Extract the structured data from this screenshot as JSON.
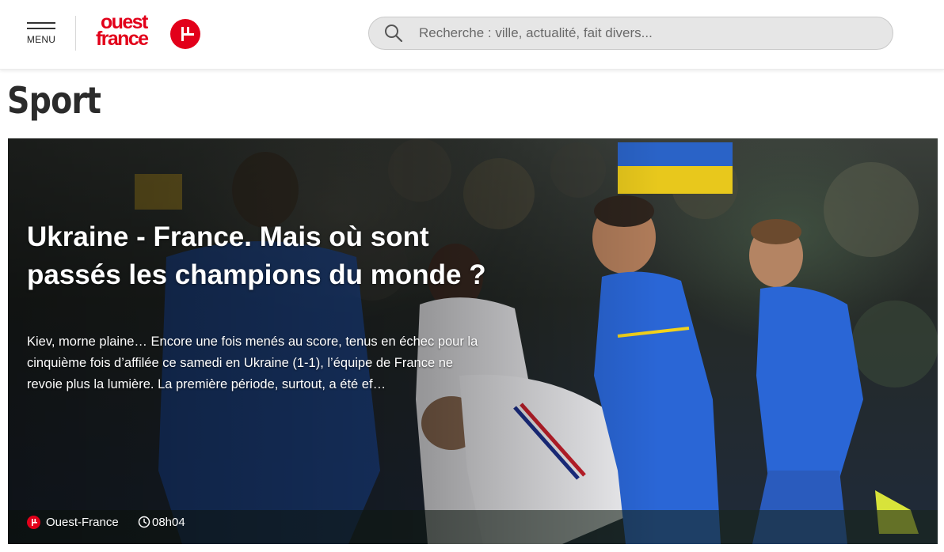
{
  "header": {
    "menu_label": "MENU",
    "logo": {
      "line1": "ouest",
      "line2": "france",
      "brand_color": "#e2001a"
    },
    "search": {
      "placeholder": "Recherche : ville, actualité, fait divers...",
      "icon": "search-icon"
    }
  },
  "section": {
    "title": "Sport"
  },
  "hero": {
    "title": "Ukraine - France. Mais où sont passés les champions du monde ?",
    "summary": "Kiev, morne plaine… Encore une fois menés au score, tenus en échec pour la cinquième fois d’affilée ce samedi en Ukraine (1-1), l’équipe de France ne revoie plus la lumière. La première période, surtout, a été ef…",
    "source": "Ouest-France",
    "time": "08h04",
    "source_icon": "ouest-france-logo-icon",
    "time_icon": "clock-icon",
    "colors": {
      "ukraine_blue": "#1f5fc9",
      "ukraine_yellow": "#f2d21b",
      "france_white": "#f2f2f2"
    }
  }
}
